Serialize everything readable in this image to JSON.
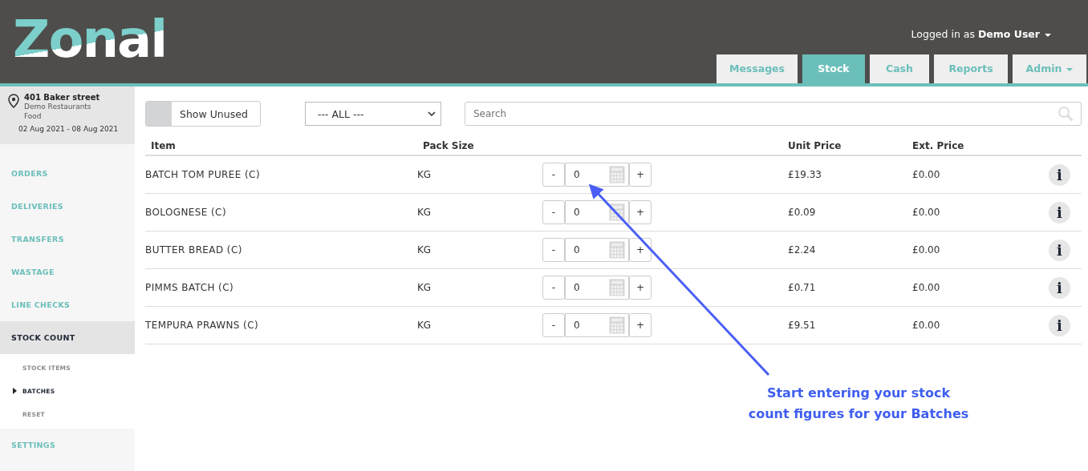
{
  "logo": {
    "text": "Zonal"
  },
  "user_menu": {
    "prefix": "Logged in as",
    "user": "Demo User"
  },
  "tabs": [
    {
      "label": "Messages",
      "selected": false,
      "dropdown": false
    },
    {
      "label": "Stock",
      "selected": true,
      "dropdown": false
    },
    {
      "label": "Cash",
      "selected": false,
      "dropdown": false
    },
    {
      "label": "Reports",
      "selected": false,
      "dropdown": false
    },
    {
      "label": "Admin",
      "selected": false,
      "dropdown": true
    }
  ],
  "location": {
    "address": "401 Baker street",
    "company": "Demo Restaurants",
    "category": "Food",
    "period": "02 Aug 2021 - 08 Aug 2021"
  },
  "sidebar": {
    "items": [
      {
        "label": "ORDERS",
        "selected": false
      },
      {
        "label": "DELIVERIES",
        "selected": false
      },
      {
        "label": "TRANSFERS",
        "selected": false
      },
      {
        "label": "WASTAGE",
        "selected": false
      },
      {
        "label": "LINE CHECKS",
        "selected": false
      },
      {
        "label": "STOCK COUNT",
        "selected": true,
        "expanded": true,
        "children": [
          {
            "label": "STOCK ITEMS",
            "selected": false
          },
          {
            "label": "BATCHES",
            "selected": true
          },
          {
            "label": "RESET",
            "selected": false
          }
        ]
      },
      {
        "label": "SETTINGS",
        "selected": false
      }
    ]
  },
  "toolbar": {
    "show_unused": {
      "label": "Show Unused",
      "on": false
    },
    "filter": {
      "value": "--- ALL ---"
    },
    "search": {
      "placeholder": "Search"
    }
  },
  "table": {
    "columns": [
      "Item",
      "Pack Size",
      "Unit Price",
      "Ext. Price"
    ],
    "rows": [
      {
        "item": "BATCH TOM PUREE (C)",
        "pack_size": "KG",
        "decrement": "-",
        "count": "0",
        "increment": "+",
        "unit_price": "£19.33",
        "ext_price": "£0.00",
        "info": "i"
      },
      {
        "item": "BOLOGNESE (C)",
        "pack_size": "KG",
        "decrement": "-",
        "count": "0",
        "increment": "+",
        "unit_price": "£0.09",
        "ext_price": "£0.00",
        "info": "i"
      },
      {
        "item": "BUTTER BREAD (C)",
        "pack_size": "KG",
        "decrement": "-",
        "count": "0",
        "increment": "+",
        "unit_price": "£2.24",
        "ext_price": "£0.00",
        "info": "i"
      },
      {
        "item": "PIMMS BATCH (C)",
        "pack_size": "KG",
        "decrement": "-",
        "count": "0",
        "increment": "+",
        "unit_price": "£0.71",
        "ext_price": "£0.00",
        "info": "i"
      },
      {
        "item": "TEMPURA PRAWNS (C)",
        "pack_size": "KG",
        "decrement": "-",
        "count": "0",
        "increment": "+",
        "unit_price": "£9.51",
        "ext_price": "£0.00",
        "info": "i"
      }
    ]
  },
  "annotation": {
    "text": "Start entering your stock count figures for your Batches"
  }
}
